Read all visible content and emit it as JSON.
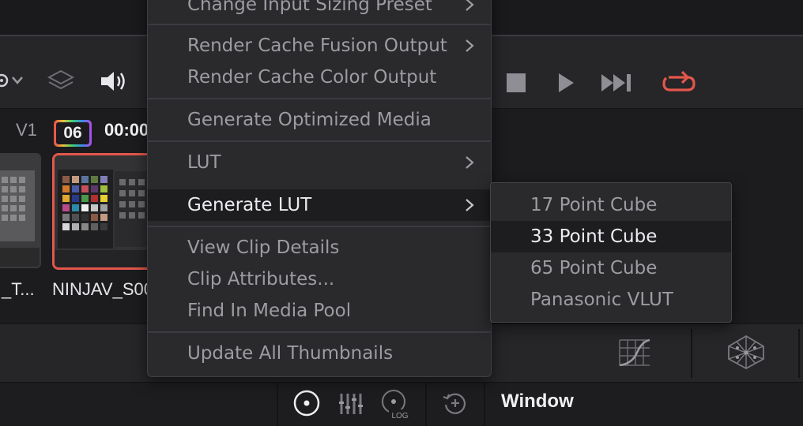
{
  "timeline": {
    "track_label": "V1",
    "clip_number": "06",
    "clip_timecode": "00:00",
    "clips": [
      {
        "name": "_T..."
      },
      {
        "name": "NINJAV_S00"
      }
    ]
  },
  "bottom_bar": {
    "window_label": "Window"
  },
  "context_menu": {
    "items": [
      {
        "label": "Change Input Sizing Preset",
        "has_submenu": true
      },
      {
        "label": "Render Cache Fusion Output",
        "has_submenu": true
      },
      {
        "label": "Render Cache Color Output",
        "has_submenu": false
      },
      {
        "label": "Generate Optimized Media",
        "has_submenu": false
      },
      {
        "label": "LUT",
        "has_submenu": true
      },
      {
        "label": "Generate LUT",
        "has_submenu": true,
        "highlighted": true
      },
      {
        "label": "View Clip Details",
        "has_submenu": false
      },
      {
        "label": "Clip Attributes...",
        "has_submenu": false
      },
      {
        "label": "Find In Media Pool",
        "has_submenu": false
      },
      {
        "label": "Update All Thumbnails",
        "has_submenu": false
      }
    ]
  },
  "generate_lut_submenu": {
    "items": [
      {
        "label": "17 Point Cube"
      },
      {
        "label": "33 Point Cube",
        "highlighted": true
      },
      {
        "label": "65 Point Cube"
      },
      {
        "label": "Panasonic VLUT"
      }
    ]
  },
  "icons": {
    "viewer_mode": "viewer-mode-icon",
    "layers": "layers-icon",
    "audio": "speaker-icon",
    "stop": "stop-icon",
    "play": "play-icon",
    "next": "skip-forward-icon",
    "loop": "loop-icon",
    "curves": "curves-icon",
    "color_warper": "color-warper-icon",
    "primaries": "primaries-wheel-icon",
    "bars": "primaries-bars-icon",
    "log": "log-wheels-icon",
    "hdr": "hdr-icon"
  },
  "colors": {
    "loop_active": "#e3574a",
    "selected_clip_border": "#e3574a",
    "menu_bg": "#2a2a2d",
    "menu_highlight": "#1d1d20"
  }
}
